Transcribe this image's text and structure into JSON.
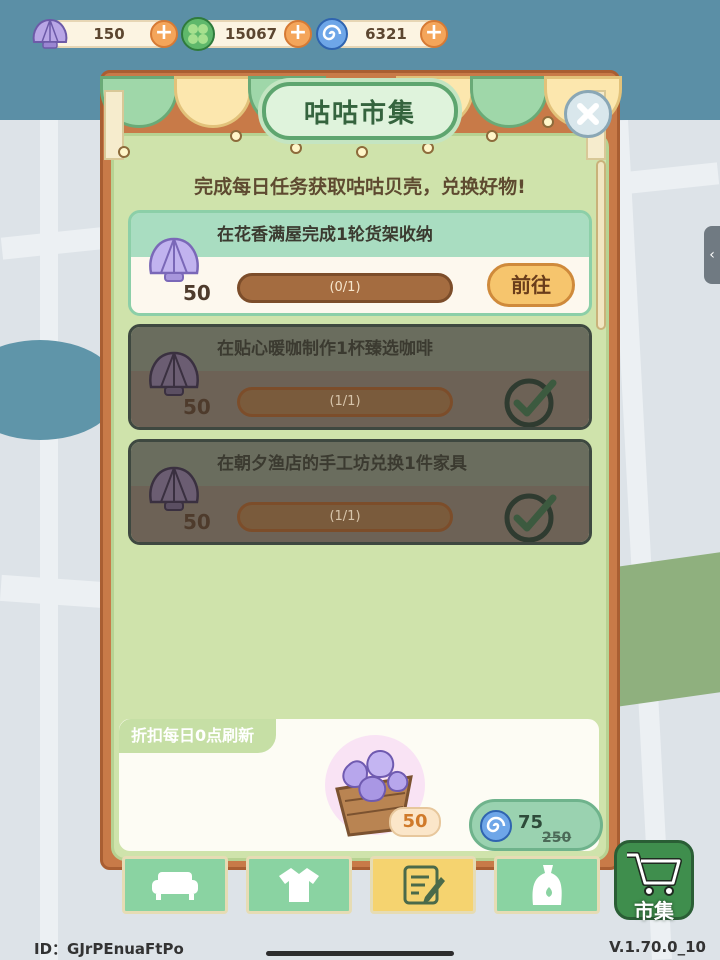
{
  "currencies": [
    {
      "name": "shell",
      "icon": "shell-icon",
      "value": "150"
    },
    {
      "name": "clover",
      "icon": "clover-icon",
      "value": "15067"
    },
    {
      "name": "swirl",
      "icon": "swirl-icon",
      "value": "6321"
    }
  ],
  "panel": {
    "title": "咕咕市集",
    "subtitle": "完成每日任务获取咕咕贝壳，兑换好物!"
  },
  "tasks": [
    {
      "label": "在花香满屋完成1轮货架收纳",
      "reward": "50",
      "progress": "(0/1)",
      "progress_fraction": 0,
      "status": "active",
      "button": "前往"
    },
    {
      "label": "在贴心暖咖制作1杯臻选咖啡",
      "reward": "50",
      "progress": "(1/1)",
      "progress_fraction": 1,
      "status": "done"
    },
    {
      "label": "在朝夕渔店的手工坊兑换1件家具",
      "reward": "50",
      "progress": "(1/1)",
      "progress_fraction": 1,
      "status": "done"
    }
  ],
  "deal": {
    "tag": "折扣每日0点刷新",
    "quantity": "50",
    "price": "75",
    "original_price": "250"
  },
  "tabs": [
    {
      "name": "sofa-icon",
      "selected": false
    },
    {
      "name": "shirt-icon",
      "selected": false
    },
    {
      "name": "note-icon",
      "selected": true
    },
    {
      "name": "bottle-icon",
      "selected": false
    }
  ],
  "market_button": "市集",
  "footer": {
    "id": "ID：GJrPEnuaFtPo",
    "version": "V.1.70.0_10"
  },
  "colors": {
    "panel_frame": "#c87a48",
    "panel_inner": "#cfe3ab",
    "title_green": "#5ea56f",
    "go_button": "#f6c56d"
  }
}
